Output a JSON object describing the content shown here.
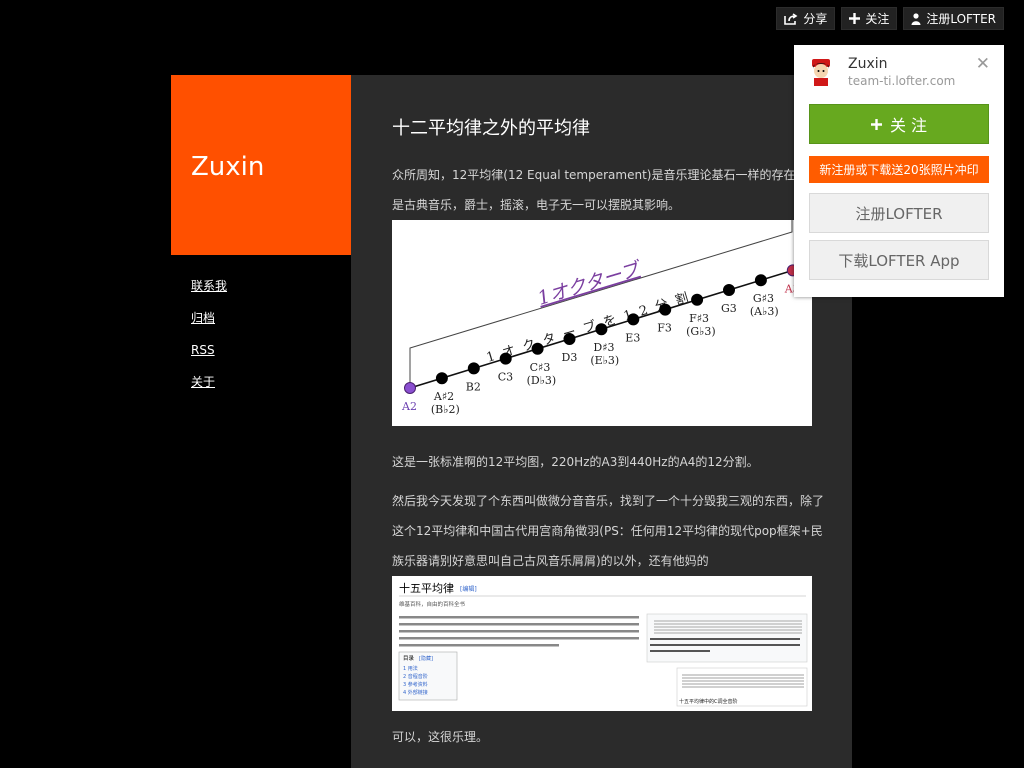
{
  "topbar": {
    "share_label": "分享",
    "follow_label": "关注",
    "register_label": "注册LOFTER"
  },
  "blog": {
    "title": "Zuxin",
    "nav": [
      "联系我",
      "归档",
      "RSS",
      "关于"
    ]
  },
  "post": {
    "title": "十二平均律之外的平均律",
    "para1": [
      "众所周知，12平均律(12 Equal temperament)是音乐理论基石一样的存在无论",
      "是古典音乐，爵士，摇滚，电子无一可以摆脱其影响。"
    ],
    "para2": [
      "这是一张标准啊的12平均图，220Hz的A3到440Hz的A4的12分割。"
    ],
    "para3": [
      "然后我今天发现了个东西叫做微分音音乐，找到了一个十分毁我三观的东西，除了",
      "这个12平均律和中国古代用宫商角徵羽(PS：任何用12平均律的现代pop框架+民",
      "族乐器请别好意思叫自己古风音乐屑屑)的以外，还有他妈的"
    ],
    "para4": [
      "可以，这很乐理。"
    ]
  },
  "diagram": {
    "octave_label": "1オクターブ",
    "division_label": "1 オ ク タ ー ブ を 1 2 分 割",
    "notes": [
      {
        "name": "A2",
        "alt": ""
      },
      {
        "name": "A♯2",
        "alt": "(B♭2)"
      },
      {
        "name": "B2",
        "alt": ""
      },
      {
        "name": "C3",
        "alt": ""
      },
      {
        "name": "C♯3",
        "alt": "(D♭3)"
      },
      {
        "name": "D3",
        "alt": ""
      },
      {
        "name": "D♯3",
        "alt": "(E♭3)"
      },
      {
        "name": "E3",
        "alt": ""
      },
      {
        "name": "F3",
        "alt": ""
      },
      {
        "name": "F♯3",
        "alt": "(G♭3)"
      },
      {
        "name": "G3",
        "alt": ""
      },
      {
        "name": "G♯3",
        "alt": "(A♭3)"
      },
      {
        "name": "A3",
        "alt": ""
      }
    ]
  },
  "wiki": {
    "title": "十五平均律",
    "edit": "[编辑]",
    "subtitle": "维基百科，自由的百科全书",
    "toc_title": "目录",
    "toc_hide": "[隐藏]",
    "toc": [
      "1 用法",
      "2 音程音阶",
      "3 参考资料",
      "4 外部链接"
    ],
    "caption": "十五平均律中的C调全音阶"
  },
  "popup": {
    "name": "Zuxin",
    "url": "team-ti.lofter.com",
    "follow": "关 注",
    "promo": "新注册或下载送20张照片冲印",
    "register": "注册LOFTER",
    "download": "下载LOFTER App"
  },
  "colors": {
    "accent": "#ff5000",
    "follow_green": "#67a91f",
    "promo_orange": "#ff5c00",
    "diagram_purple": "#7b3fa0"
  }
}
